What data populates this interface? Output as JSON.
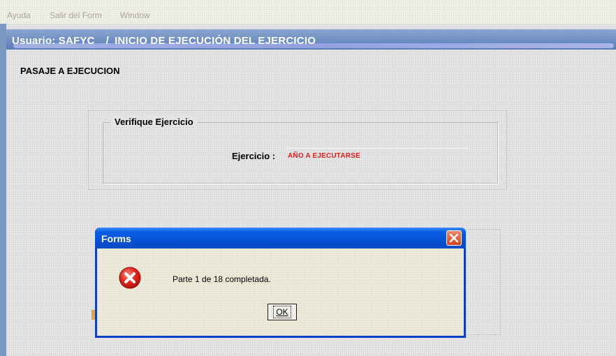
{
  "menu": {
    "items": [
      "Ayuda",
      "Salir del Form",
      "Window"
    ]
  },
  "window": {
    "user_label": "Usuario: SAFYC",
    "separator": "/",
    "title": "INICIO DE EJECUCIÓN DEL EJERCICIO"
  },
  "page": {
    "heading": "PASAJE A EJECUCION"
  },
  "group": {
    "title": "Verifique Ejercicio",
    "field_label": "Ejercicio :",
    "field_value": "AÑO A EJECUTARSE"
  },
  "dialog": {
    "title": "Forms",
    "message": "Parte 1 de 18 completada.",
    "ok_label": "OK",
    "close_icon": "close-icon",
    "error_icon": "error-icon"
  },
  "colors": {
    "title_bar": "#6f8fc2",
    "dialog_title": "#0651d6",
    "field_value": "#e31c1c",
    "close_button": "#d4431c"
  }
}
